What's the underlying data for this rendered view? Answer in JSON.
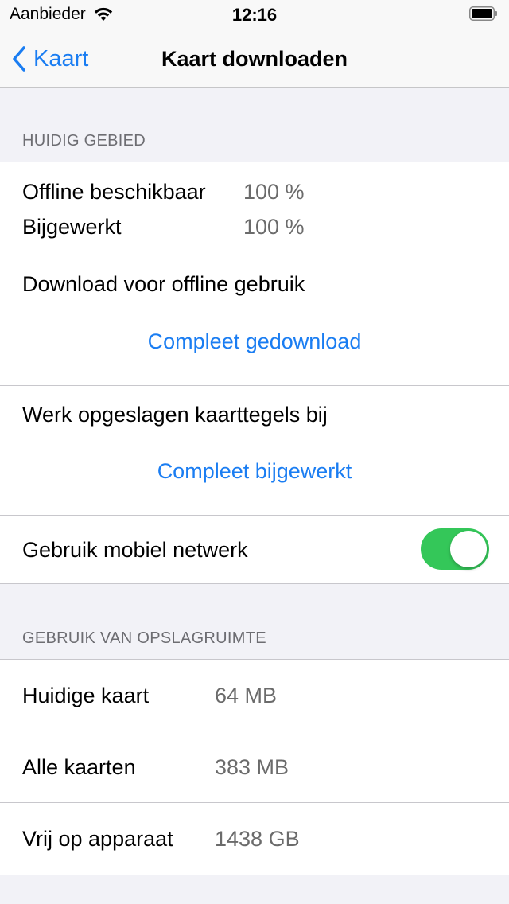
{
  "status_bar": {
    "carrier": "Aanbieder",
    "time": "12:16"
  },
  "nav": {
    "back_label": "Kaart",
    "title": "Kaart downloaden"
  },
  "current_area": {
    "header": "HUIDIG GEBIED",
    "offline_label": "Offline beschikbaar",
    "offline_value": "100 %",
    "updated_label": "Bijgewerkt",
    "updated_value": "100 %",
    "download_label": "Download voor offline gebruik",
    "download_action": "Compleet gedownload",
    "update_label": "Werk opgeslagen kaarttegels bij",
    "update_action": "Compleet bijgewerkt",
    "mobile_label": "Gebruik mobiel netwerk",
    "mobile_enabled": true
  },
  "storage": {
    "header": "GEBRUIK VAN OPSLAGRUIMTE",
    "rows": [
      {
        "label": "Huidige kaart",
        "value": "64 MB"
      },
      {
        "label": "Alle kaarten",
        "value": "383 MB"
      },
      {
        "label": "Vrij op apparaat",
        "value": "1438 GB"
      }
    ]
  },
  "colors": {
    "accent": "#1a7df2",
    "toggle_on": "#34c759",
    "background": "#f2f2f7"
  }
}
